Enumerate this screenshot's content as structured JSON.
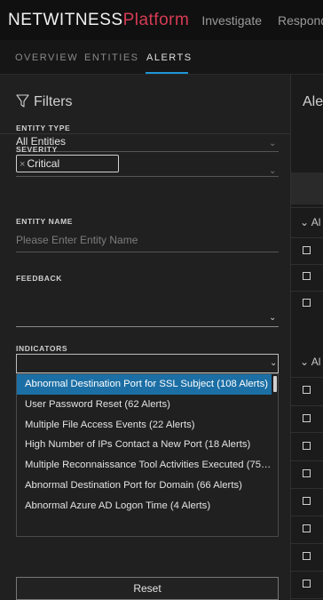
{
  "header": {
    "brand_primary": "NETWITNESS",
    "brand_secondary": "Platform",
    "nav": [
      "Investigate",
      "Respond"
    ]
  },
  "tabs": [
    {
      "label": "OVERVIEW",
      "active": false
    },
    {
      "label": "ENTITIES",
      "active": false
    },
    {
      "label": "ALERTS",
      "active": true
    }
  ],
  "filters": {
    "title": "Filters",
    "entity_type": {
      "label": "ENTITY TYPE",
      "value": "All Entities"
    },
    "severity": {
      "label": "SEVERITY",
      "chip_remove": "×",
      "chip": "Critical"
    },
    "entity_name": {
      "label": "ENTITY NAME",
      "placeholder": "Please Enter Entity Name"
    },
    "feedback": {
      "label": "FEEDBACK",
      "value": ""
    },
    "indicators": {
      "label": "INDICATORS",
      "options": [
        "Abnormal Destination Port for SSL Subject (108 Alerts)",
        "User Password Reset (62 Alerts)",
        "Multiple File Access Events (22 Alerts)",
        "High Number of IPs Contact a New Port (18 Alerts)",
        "Multiple Reconnaissance Tool Activities Executed (75 Aler...",
        "Abnormal Destination Port for Domain (66 Alerts)",
        "Abnormal Azure AD Logon Time (4 Alerts)"
      ],
      "selected_index": 0
    },
    "reset_label": "Reset"
  },
  "alerts_panel": {
    "title": "Alerts",
    "group_label": "Al"
  },
  "colors": {
    "accent": "#1e96d6",
    "brand_red": "#d63c54",
    "selected_bg": "#1c6fa5"
  }
}
